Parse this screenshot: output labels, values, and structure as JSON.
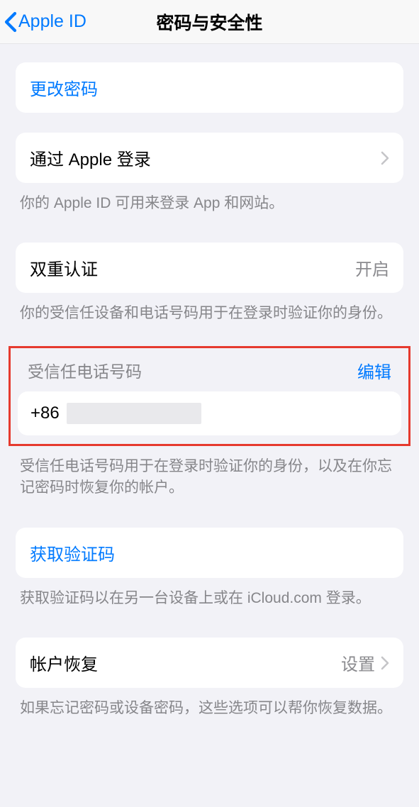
{
  "nav": {
    "back_label": "Apple ID",
    "title": "密码与安全性"
  },
  "change_password": {
    "label": "更改密码"
  },
  "sign_in_with_apple": {
    "label": "通过 Apple 登录",
    "footer": "你的 Apple ID 可用来登录 App 和网站。"
  },
  "two_factor": {
    "label": "双重认证",
    "value": "开启",
    "footer": "你的受信任设备和电话号码用于在登录时验证你的身份。"
  },
  "trusted_phone": {
    "header": "受信任电话号码",
    "edit": "编辑",
    "country": "+86",
    "footer": "受信任电话号码用于在登录时验证你的身份，以及在你忘记密码时恢复你的帐户。"
  },
  "get_code": {
    "label": "获取验证码",
    "footer": "获取验证码以在另一台设备上或在 iCloud.com 登录。"
  },
  "account_recovery": {
    "label": "帐户恢复",
    "value": "设置",
    "footer": "如果忘记密码或设备密码，这些选项可以帮你恢复数据。"
  }
}
